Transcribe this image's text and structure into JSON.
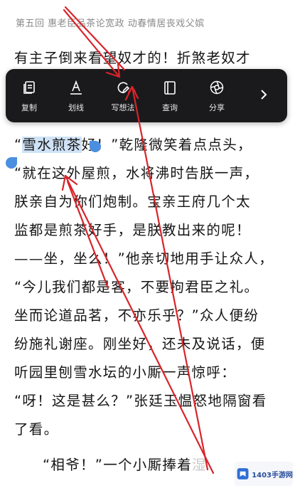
{
  "chapter_title": "第五回 惠老臣品茶论宽政 动春情居丧戏父嫔",
  "lines": [
    "有主子倒来看望奴才的！折煞老奴才",
    "好！”乾隆微笑着点点头，",
    "“就在这外屋煎，水将沸时告朕一声，",
    "朕亲自为你们炮制。宝亲王府几个太",
    "监都是煎茶好手，是朕教出来的呢！",
    "——坐，坐么！”他亲切地用手让众人，",
    "“今儿我们都是客，不要拘君臣之礼。",
    "坐而论道品茗，不亦乐乎？”众人便纷",
    "纷施礼谢座。刚坐好，还未及说话，便",
    "听园里刨雪水坛的小厮一声惊呼：",
    "“呀！这是甚么？”张廷玉愠怒地隔窗看",
    "了看。"
  ],
  "selected_open_quote": "“",
  "selected_text": "雪水煎茶",
  "last_line_visible": "“相爷！”一个小厮捧着",
  "last_line_faded": "湿",
  "toolbar": {
    "items": [
      {
        "label": "复制",
        "icon": "copy-icon"
      },
      {
        "label": "划线",
        "icon": "underline-icon"
      },
      {
        "label": "写想法",
        "icon": "write-thought-icon"
      },
      {
        "label": "查询",
        "icon": "lookup-icon"
      },
      {
        "label": "分享",
        "icon": "share-icon"
      }
    ],
    "more_icon": "chevron-right-icon",
    "background": "#1a1a1c"
  },
  "selection_color": "#cfe2f6",
  "handle_color": "#4a8fe0",
  "annotation_arrow_color": "#d8242a",
  "watermark": {
    "text": "1403手游网"
  }
}
